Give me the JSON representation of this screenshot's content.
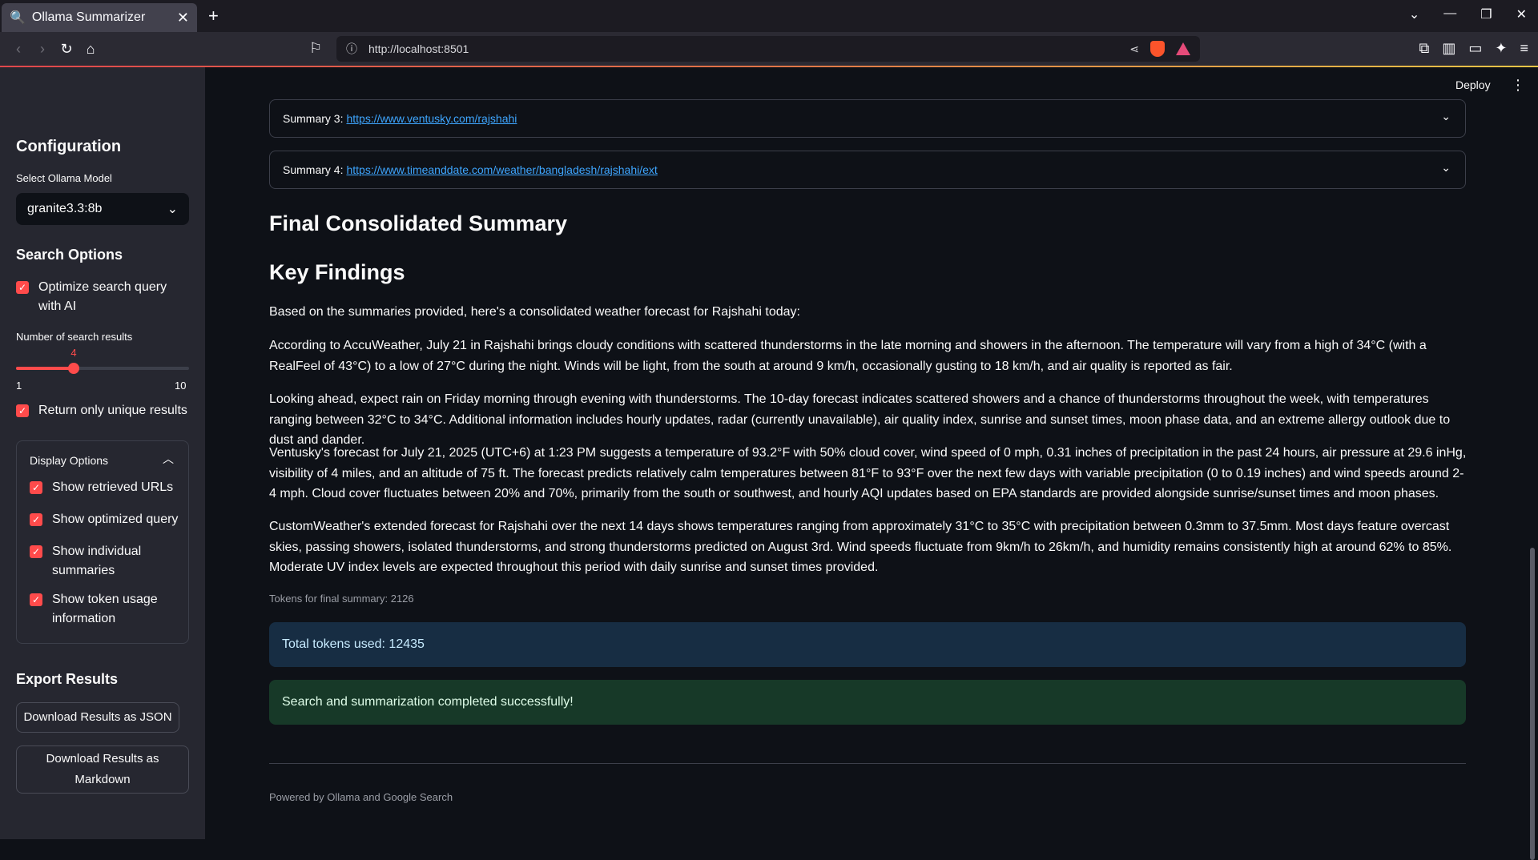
{
  "browser": {
    "tab_title": "Ollama Summarizer",
    "url": "http://localhost:8501"
  },
  "sidebar": {
    "config_heading": "Configuration",
    "model_label": "Select Ollama Model",
    "model_value": "granite3.3:8b",
    "search_heading": "Search Options",
    "optimize_label": "Optimize search query with AI",
    "num_results_label": "Number of search results",
    "num_results": {
      "value": 4,
      "min": 1,
      "max": 10,
      "min_label": "1",
      "max_label": "10",
      "value_label": "4"
    },
    "unique_label": "Return only unique results",
    "display_heading": "Display Options",
    "display_options": [
      "Show retrieved URLs",
      "Show optimized query",
      "Show individual summaries",
      "Show token usage information"
    ],
    "export_heading": "Export Results",
    "json_button": "Download Results as JSON",
    "md_button": "Download Results as Markdown"
  },
  "header": {
    "deploy_label": "Deploy"
  },
  "summaries": [
    {
      "label": "Summary 3:",
      "url": "https://www.ventusky.com/rajshahi"
    },
    {
      "label": "Summary 4:",
      "url": "https://www.timeanddate.com/weather/bangladesh/rajshahi/ext"
    }
  ],
  "final_heading": "Final Consolidated Summary",
  "findings_heading": "Key Findings",
  "paragraphs": [
    "Based on the summaries provided, here's a consolidated weather forecast for Rajshahi today:",
    "According to AccuWeather, July 21 in Rajshahi brings cloudy conditions with scattered thunderstorms in the late morning and showers in the afternoon. The temperature will vary from a high of 34°C (with a RealFeel of 43°C) to a low of 27°C during the night. Winds will be light, from the south at around 9 km/h, occasionally gusting to 18 km/h, and air quality is reported as fair.",
    "Looking ahead, expect rain on Friday morning through evening with thunderstorms. The 10-day forecast indicates scattered showers and a chance of thunderstorms throughout the week, with temperatures ranging between 32°C to 34°C. Additional information includes hourly updates, radar (currently unavailable), air quality index, sunrise and sunset times, moon phase data, and an extreme allergy outlook due to dust and dander.",
    "Ventusky's forecast for July 21, 2025 (UTC+6) at 1:23 PM suggests a temperature of 93.2°F with 50% cloud cover, wind speed of 0 mph, 0.31 inches of precipitation in the past 24 hours, air pressure at 29.6 inHg, visibility of 4 miles, and an altitude of 75 ft. The forecast predicts relatively calm temperatures between 81°F to 93°F over the next few days with variable precipitation (0 to 0.19 inches) and wind speeds around 2-4 mph. Cloud cover fluctuates between 20% and 70%, primarily from the south or southwest, and hourly AQI updates based on EPA standards are provided alongside sunrise/sunset times and moon phases.",
    "CustomWeather's extended forecast for Rajshahi over the next 14 days shows temperatures ranging from approximately 31°C to 35°C with precipitation between 0.3mm to 37.5mm. Most days feature overcast skies, passing showers, isolated thunderstorms, and strong thunderstorms predicted on August 3rd. Wind speeds fluctuate from 9km/h to 26km/h, and humidity remains consistently high at around 62% to 85%. Moderate UV index levels are expected throughout this period with daily sunrise and sunset times provided."
  ],
  "tokens_caption": "Tokens for final summary: 2126",
  "total_tokens": "Total tokens used: 12435",
  "success_message": "Search and summarization completed successfully!",
  "footer": "Powered by Ollama and Google Search",
  "colors": {
    "accent": "#ff4b4b",
    "info_bg": "#172d43",
    "success_bg": "#173928",
    "link": "#3ea6ff"
  }
}
